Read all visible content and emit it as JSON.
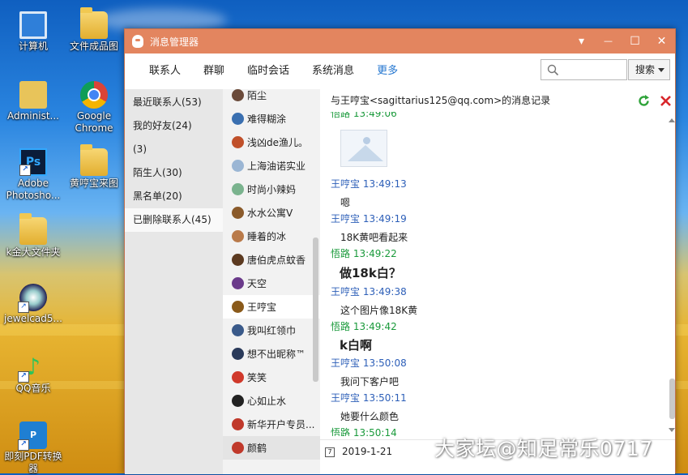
{
  "desktop": {
    "icons": [
      {
        "label": "计算机",
        "icon": "computer-icon"
      },
      {
        "label": "文件成品图",
        "icon": "folder-icon"
      },
      {
        "label": "Administ...",
        "icon": "user-folder-icon"
      },
      {
        "label": "Google Chrome",
        "icon": "chrome-icon"
      },
      {
        "label": "Adobe Photosho...",
        "icon": "photoshop-icon"
      },
      {
        "label": "黄哼宝来图",
        "icon": "folder-icon"
      },
      {
        "label": "k金大文件夹",
        "icon": "folder-icon"
      },
      {
        "label": "jewelcad5...",
        "icon": "jewelcad-icon"
      },
      {
        "label": "QQ音乐",
        "icon": "qq-music-icon"
      },
      {
        "label": "即刻PDF转换器",
        "icon": "pdf-converter-icon"
      }
    ]
  },
  "window": {
    "title": "消息管理器",
    "controls": {
      "dropdown": "▾",
      "minimize": "—",
      "maximize": "☐",
      "close": "✕"
    }
  },
  "toolbar": {
    "tabs": [
      {
        "label": "联系人",
        "active": false
      },
      {
        "label": "群聊",
        "active": false
      },
      {
        "label": "临时会话",
        "active": false
      },
      {
        "label": "系统消息",
        "active": false
      },
      {
        "label": "更多",
        "active": true
      }
    ],
    "search_placeholder": "",
    "search_button": "搜索"
  },
  "nav": {
    "items": [
      {
        "label": "最近联系人(53)",
        "active": false
      },
      {
        "label": "我的好友(24)",
        "active": false
      },
      {
        "label": "(3)",
        "active": false
      },
      {
        "label": "陌生人(30)",
        "active": false
      },
      {
        "label": "黑名单(20)",
        "active": false
      },
      {
        "label": "已删除联系人(45)",
        "active": true
      }
    ]
  },
  "contacts": [
    {
      "name": "陌尘",
      "color": "#6a4a3a",
      "active": false
    },
    {
      "name": "难得糊涂",
      "color": "#3a6fb0",
      "active": false
    },
    {
      "name": "浅凶de渔儿。",
      "color": "#c0502a",
      "active": false
    },
    {
      "name": "上海油诺实业",
      "color": "#9bb6d4",
      "active": false
    },
    {
      "name": "时尚小辣妈",
      "color": "#7ab38e",
      "active": false
    },
    {
      "name": "水水公寓V",
      "color": "#8a5a2a",
      "active": false
    },
    {
      "name": "睡着的冰",
      "color": "#b97a4a",
      "active": false
    },
    {
      "name": "唐伯虎点蚊香",
      "color": "#5c3a20",
      "active": false
    },
    {
      "name": "天空",
      "color": "#6a3a8a",
      "active": false
    },
    {
      "name": "王哼宝",
      "color": "#8a5a1a",
      "active": true
    },
    {
      "name": "我叫红领巾",
      "color": "#3a5a8a",
      "active": false
    },
    {
      "name": "想不出昵称™",
      "color": "#2a3a5a",
      "active": false
    },
    {
      "name": "笑笑",
      "color": "#d0392b",
      "active": false
    },
    {
      "name": "心如止水",
      "color": "#222222",
      "active": false
    },
    {
      "name": "新华开户专员...",
      "color": "#c0392b",
      "active": false
    },
    {
      "name": "颜鹤",
      "color": "#c0392b",
      "active": false,
      "hover": true
    }
  ],
  "chat": {
    "header": "与王哼宝<sagittarius125@qq.com>的消息记录",
    "messages": [
      {
        "sender": "悟路",
        "time": "13:49:06",
        "side": "me",
        "type": "image",
        "text": ""
      },
      {
        "sender": "王哼宝",
        "time": "13:49:13",
        "side": "them",
        "type": "text",
        "text": "嗯"
      },
      {
        "sender": "王哼宝",
        "time": "13:49:19",
        "side": "them",
        "type": "text",
        "text": "18K黄吧看起来"
      },
      {
        "sender": "悟路",
        "time": "13:49:22",
        "side": "me",
        "type": "big",
        "text": "做18k白？"
      },
      {
        "sender": "王哼宝",
        "time": "13:49:38",
        "side": "them",
        "type": "text",
        "text": "这个图片像18K黄"
      },
      {
        "sender": "悟路",
        "time": "13:49:42",
        "side": "me",
        "type": "big",
        "text": "k白啊"
      },
      {
        "sender": "王哼宝",
        "time": "13:50:08",
        "side": "them",
        "type": "text",
        "text": "我问下客户吧"
      },
      {
        "sender": "王哼宝",
        "time": "13:50:11",
        "side": "them",
        "type": "text",
        "text": "她要什么颜色"
      },
      {
        "sender": "悟路",
        "time": "13:50:14",
        "side": "me",
        "type": "none",
        "text": ""
      }
    ],
    "footer_date": "2019-1-21",
    "calendar_glyph": "7"
  },
  "watermark": "大家坛@知足常乐0717",
  "colors": {
    "titlebar": "#e3855f",
    "accent_blue": "#2376d0",
    "peer_name": "#2d5fb8",
    "self_name": "#1a9a3b"
  }
}
